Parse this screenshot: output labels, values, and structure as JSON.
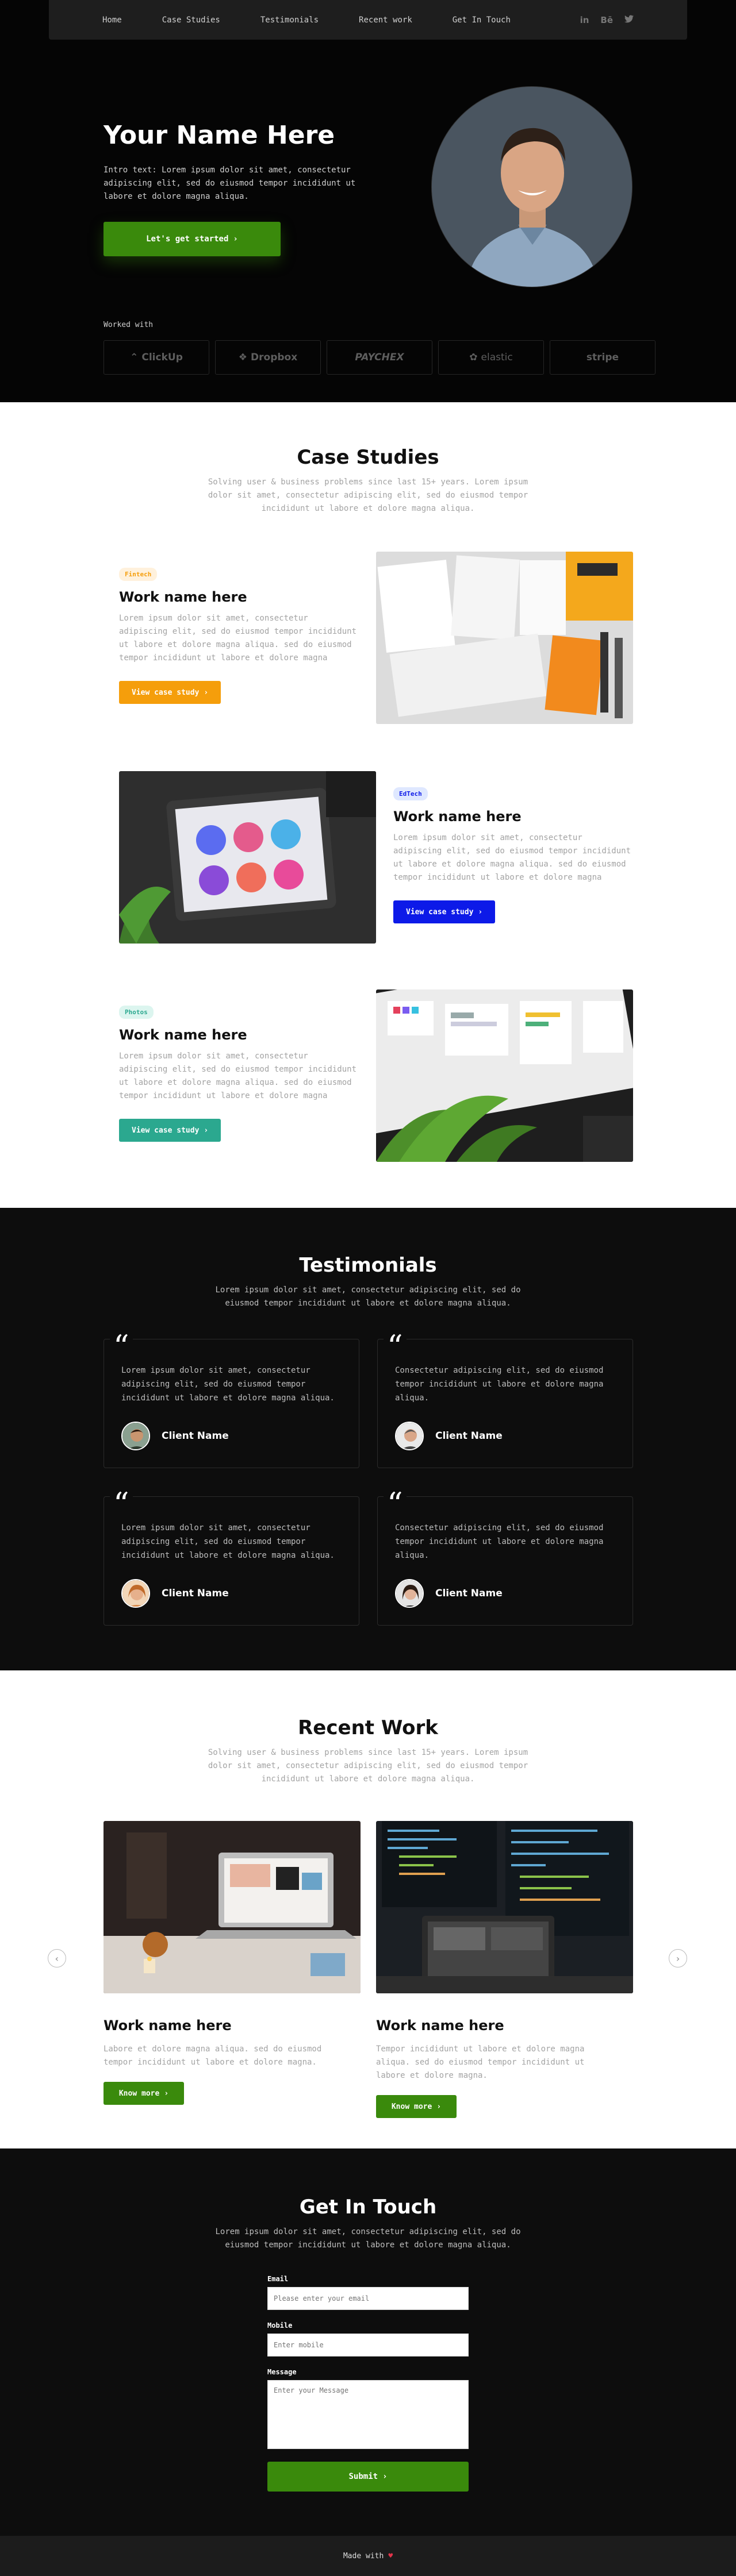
{
  "nav": {
    "links": [
      "Home",
      "Case Studies",
      "Testimonials",
      "Recent work",
      "Get In Touch"
    ],
    "social": [
      {
        "icon": "linkedin-icon",
        "glyph": "in"
      },
      {
        "icon": "behance-icon",
        "glyph": "Bē"
      },
      {
        "icon": "twitter-icon",
        "glyph": "🐦"
      }
    ]
  },
  "hero": {
    "title": "Your Name Here",
    "intro": "Intro text: Lorem ipsum dolor sit amet, consectetur adipiscing elit, sed do eiusmod tempor incididunt ut labore et dolore magna aliqua.",
    "cta": "Let's get started",
    "worked_with": "Worked with",
    "logos": [
      "ClickUp",
      "Dropbox",
      "PAYCHEX",
      "elastic",
      "stripe"
    ]
  },
  "case_studies": {
    "title": "Case Studies",
    "subtitle": "Solving user & business problems since last 15+ years. Lorem ipsum dolor sit amet, consectetur adipiscing elit, sed do eiusmod tempor incididunt ut labore et dolore magna aliqua.",
    "items": [
      {
        "tag": "Fintech",
        "title": "Work name here",
        "text": "Lorem ipsum dolor sit amet, consectetur adipiscing elit, sed do eiusmod tempor incididunt ut labore et dolore magna aliqua. sed do eiusmod tempor incididunt ut labore et dolore magna",
        "button": "View case study",
        "color": "#f59e0b",
        "tag_bg": "#fff1dc",
        "tag_fg": "#f59e0b"
      },
      {
        "tag": "EdTech",
        "title": "Work name here",
        "text": "Lorem ipsum dolor sit amet, consectetur adipiscing elit, sed do eiusmod tempor incididunt ut labore et dolore magna aliqua. sed do eiusmod tempor incididunt ut labore et dolore magna",
        "button": "View case study",
        "color": "#0d1ae8",
        "tag_bg": "#dfe8ff",
        "tag_fg": "#0d1ae8"
      },
      {
        "tag": "Photos",
        "title": "Work name here",
        "text": "Lorem ipsum dolor sit amet, consectetur adipiscing elit, sed do eiusmod tempor incididunt ut labore et dolore magna aliqua. sed do eiusmod tempor incididunt ut labore et dolore magna",
        "button": "View case study",
        "color": "#2ba88f",
        "tag_bg": "#dcf5ef",
        "tag_fg": "#2ba88f"
      }
    ]
  },
  "testimonials": {
    "title": "Testimonials",
    "subtitle": "Lorem ipsum dolor sit amet, consectetur adipiscing elit, sed do eiusmod tempor incididunt ut labore et dolore magna aliqua.",
    "items": [
      {
        "text": "Lorem ipsum dolor sit amet, consectetur adipiscing elit, sed do eiusmod tempor incididunt ut labore et dolore magna aliqua.",
        "name": "Client Name"
      },
      {
        "text": "Consectetur adipiscing elit, sed do eiusmod tempor incididunt ut labore et dolore magna aliqua.",
        "name": "Client Name"
      },
      {
        "text": "Lorem ipsum dolor sit amet, consectetur adipiscing elit, sed do eiusmod tempor incididunt ut labore et dolore magna aliqua.",
        "name": "Client Name"
      },
      {
        "text": "Consectetur adipiscing elit, sed do eiusmod tempor incididunt ut labore et dolore magna aliqua.",
        "name": "Client Name"
      }
    ]
  },
  "recent_work": {
    "title": "Recent Work",
    "subtitle": "Solving user & business problems since last 15+ years. Lorem ipsum dolor sit amet, consectetur adipiscing elit, sed do eiusmod tempor incididunt ut labore et dolore magna aliqua.",
    "items": [
      {
        "title": "Work name here",
        "text": "Labore et dolore magna aliqua. sed do eiusmod tempor incididunt ut labore et dolore magna.",
        "button": "Know more"
      },
      {
        "title": "Work name here",
        "text": "Tempor incididunt ut labore et dolore magna aliqua. sed do eiusmod tempor incididunt ut labore et dolore magna.",
        "button": "Know more"
      }
    ]
  },
  "contact": {
    "title": "Get In Touch",
    "subtitle": "Lorem ipsum dolor sit amet, consectetur adipiscing elit, sed do eiusmod tempor incididunt ut labore et dolore magna aliqua.",
    "email_label": "Email",
    "email_placeholder": "Please enter your email",
    "mobile_label": "Mobile",
    "mobile_placeholder": "Enter mobile",
    "message_label": "Message",
    "message_placeholder": "Enter your Message",
    "submit": "Submit"
  },
  "footer": {
    "text": "Made with",
    "heart": "♥"
  },
  "colors": {
    "accent_green": "#3a8a0c"
  }
}
